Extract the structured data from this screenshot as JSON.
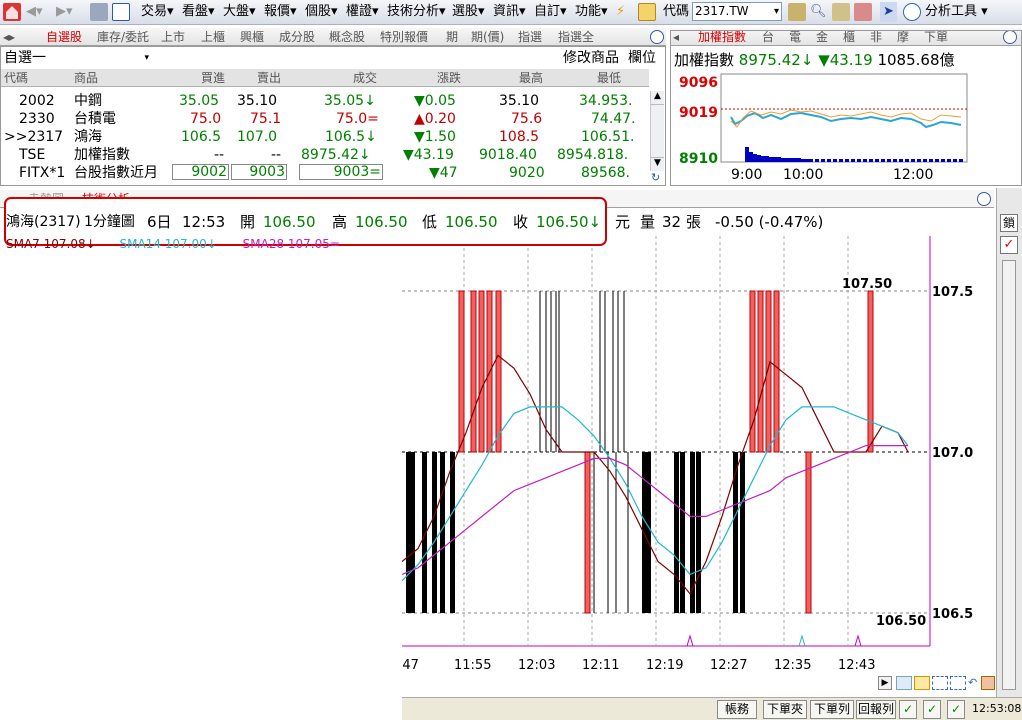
{
  "toolbar": {
    "menus": [
      "交易",
      "看盤",
      "大盤",
      "報價",
      "個股",
      "權證",
      "技術分析",
      "選股",
      "資訊",
      "自訂",
      "功能"
    ],
    "code_label": "代碼",
    "code_value": "2317.TW",
    "analysis_tools": "分析工具"
  },
  "quote_tabs": [
    "自選股",
    "庫存/委託",
    "上市",
    "上櫃",
    "興櫃",
    "成分股",
    "概念股",
    "特別報價",
    "期",
    "期(價)",
    "指選",
    "指選全"
  ],
  "watchlist": {
    "name": "自選一",
    "edit_label": "修改商品",
    "column_label": "欄位"
  },
  "quote_columns": [
    "代碼",
    "商品",
    "買進",
    "賣出",
    "成交",
    "漲跌",
    "最高",
    "最低"
  ],
  "quote_rows": [
    {
      "code": "2002",
      "name": "中鋼",
      "bid": "35.05",
      "ask": "35.10",
      "last": "35.05↓",
      "change": "▼0.05",
      "high": "35.10",
      "low": "34.953."
    },
    {
      "code": "2330",
      "name": "台積電",
      "bid": "75.0",
      "ask": "75.1",
      "last": "75.0=",
      "change": "▲0.20",
      "high": "75.6",
      "low": "74.47."
    },
    {
      "code": ">>2317",
      "name": "鴻海",
      "bid": "106.5",
      "ask": "107.0",
      "last": "106.5↓",
      "change": "▼1.50",
      "high": "108.5",
      "low": "106.51."
    },
    {
      "code": "TSE",
      "name": "加權指數",
      "bid": "--",
      "ask": "--",
      "last": "8975.42↓",
      "change": "▼43.19",
      "high": "9018.40",
      "low": "8954.818."
    },
    {
      "code": "FITX*1",
      "name": "台股指數近月",
      "bid": "9002",
      "ask": "9003",
      "last": "9003=",
      "change": "▼47",
      "high": "9020",
      "low": "89568."
    }
  ],
  "index_tabs": [
    "加權指數",
    "台",
    "電",
    "金",
    "櫃",
    "非",
    "摩",
    "下單"
  ],
  "index_summary": {
    "name": "加權指數",
    "value": "8975.42↓",
    "change": "▼43.19",
    "volume": "1085.68億"
  },
  "index_chart": {
    "y_labels": [
      "9096",
      "9019",
      "8910"
    ],
    "x_labels": [
      "9:00",
      "10:00",
      "12:00"
    ]
  },
  "tech_tabs": [
    "走勢圖",
    "技術分析"
  ],
  "info_bar": {
    "stock": "鴻海(2317)",
    "period": "1分鐘圖",
    "date": "6日",
    "time": "12:53",
    "open_label": "開",
    "open": "106.50",
    "high_label": "高",
    "high": "106.50",
    "low_label": "低",
    "low": "106.50",
    "close_label": "收",
    "close": "106.50↓",
    "unit": "元",
    "vol_label": "量",
    "vol": "32",
    "vol_unit": "張",
    "change": "-0.50 (-0.47%)"
  },
  "sma_legend": {
    "sma7": "SMA7 107.08↓",
    "sma14": "SMA14 107.00↓",
    "sma28": "SMA28 107.05="
  },
  "chart_data": {
    "type": "line",
    "x_labels": [
      ":47",
      "11:55",
      "12:03",
      "12:11",
      "12:19",
      "12:27",
      "12:35",
      "12:43"
    ],
    "y_ticks": [
      "107.5",
      "107.0",
      "106.5"
    ],
    "y_range": [
      106.5,
      107.5
    ],
    "max_label": "107.50",
    "min_label": "106.50"
  },
  "right_bar": {
    "label": "鎖"
  },
  "status_bar": {
    "buttons": [
      "帳務",
      "下單夾",
      "下單列",
      "回報列"
    ],
    "time": "12:53:08"
  },
  "colors": {
    "up": "#c00000",
    "down": "#008000",
    "accent_red": "#d00000"
  }
}
